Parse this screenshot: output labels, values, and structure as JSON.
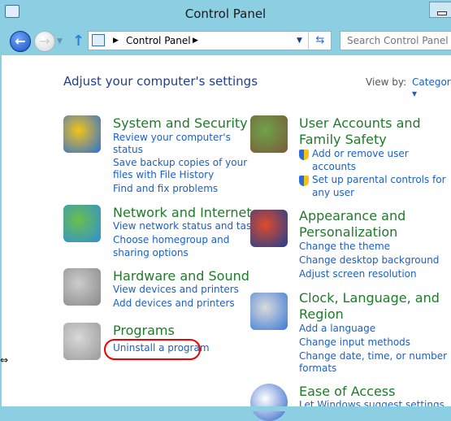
{
  "window": {
    "title": "Control Panel"
  },
  "nav": {
    "back": "←",
    "forward": "→",
    "up": "↑",
    "breadcrumb": "Control Panel",
    "search_placeholder": "Search Control Panel"
  },
  "header": {
    "title": "Adjust your computer's settings",
    "view_by_label": "View by:",
    "view_by_value": "Category ▾"
  },
  "categories": [
    {
      "title": [
        "System and Security"
      ],
      "icon": "shield-computer-icon",
      "links": [
        "Review your computer's",
        "status",
        "Save backup copies of your",
        "files with File History",
        "Find and fix problems"
      ]
    },
    {
      "title": [
        "Network and Internet"
      ],
      "icon": "globe-network-icon",
      "links": [
        "View network status and tasks",
        "Choose homegroup and",
        "sharing options"
      ]
    },
    {
      "title": [
        "Hardware and Sound"
      ],
      "icon": "printer-speaker-icon",
      "links": [
        "View devices and printers",
        "Add devices and printers"
      ]
    },
    {
      "title": [
        "Programs"
      ],
      "icon": "programs-box-icon",
      "links": [
        "Uninstall a program"
      ]
    },
    {
      "title": [
        "User Accounts and",
        "Family Safety"
      ],
      "icon": "users-icon",
      "links": [
        "Add or remove user",
        "accounts",
        "Set up parental controls for",
        "any user"
      ]
    },
    {
      "title": [
        "Appearance and",
        "Personalization"
      ],
      "icon": "monitor-palette-icon",
      "links": [
        "Change the theme",
        "Change desktop background",
        "Adjust screen resolution"
      ]
    },
    {
      "title": [
        "Clock, Language, and",
        "Region"
      ],
      "icon": "clock-globe-icon",
      "links": [
        "Add a language",
        "Change input methods",
        "Change date, time, or number",
        "formats"
      ]
    },
    {
      "title": [
        "Ease of Access"
      ],
      "icon": "ease-of-access-icon",
      "links": [
        "Let Windows suggest settings"
      ]
    }
  ],
  "colors": {
    "heading": "#1f7a2a",
    "link": "#1a5fc8",
    "highlight": "#e00000",
    "frame": "#8ccfe3"
  }
}
